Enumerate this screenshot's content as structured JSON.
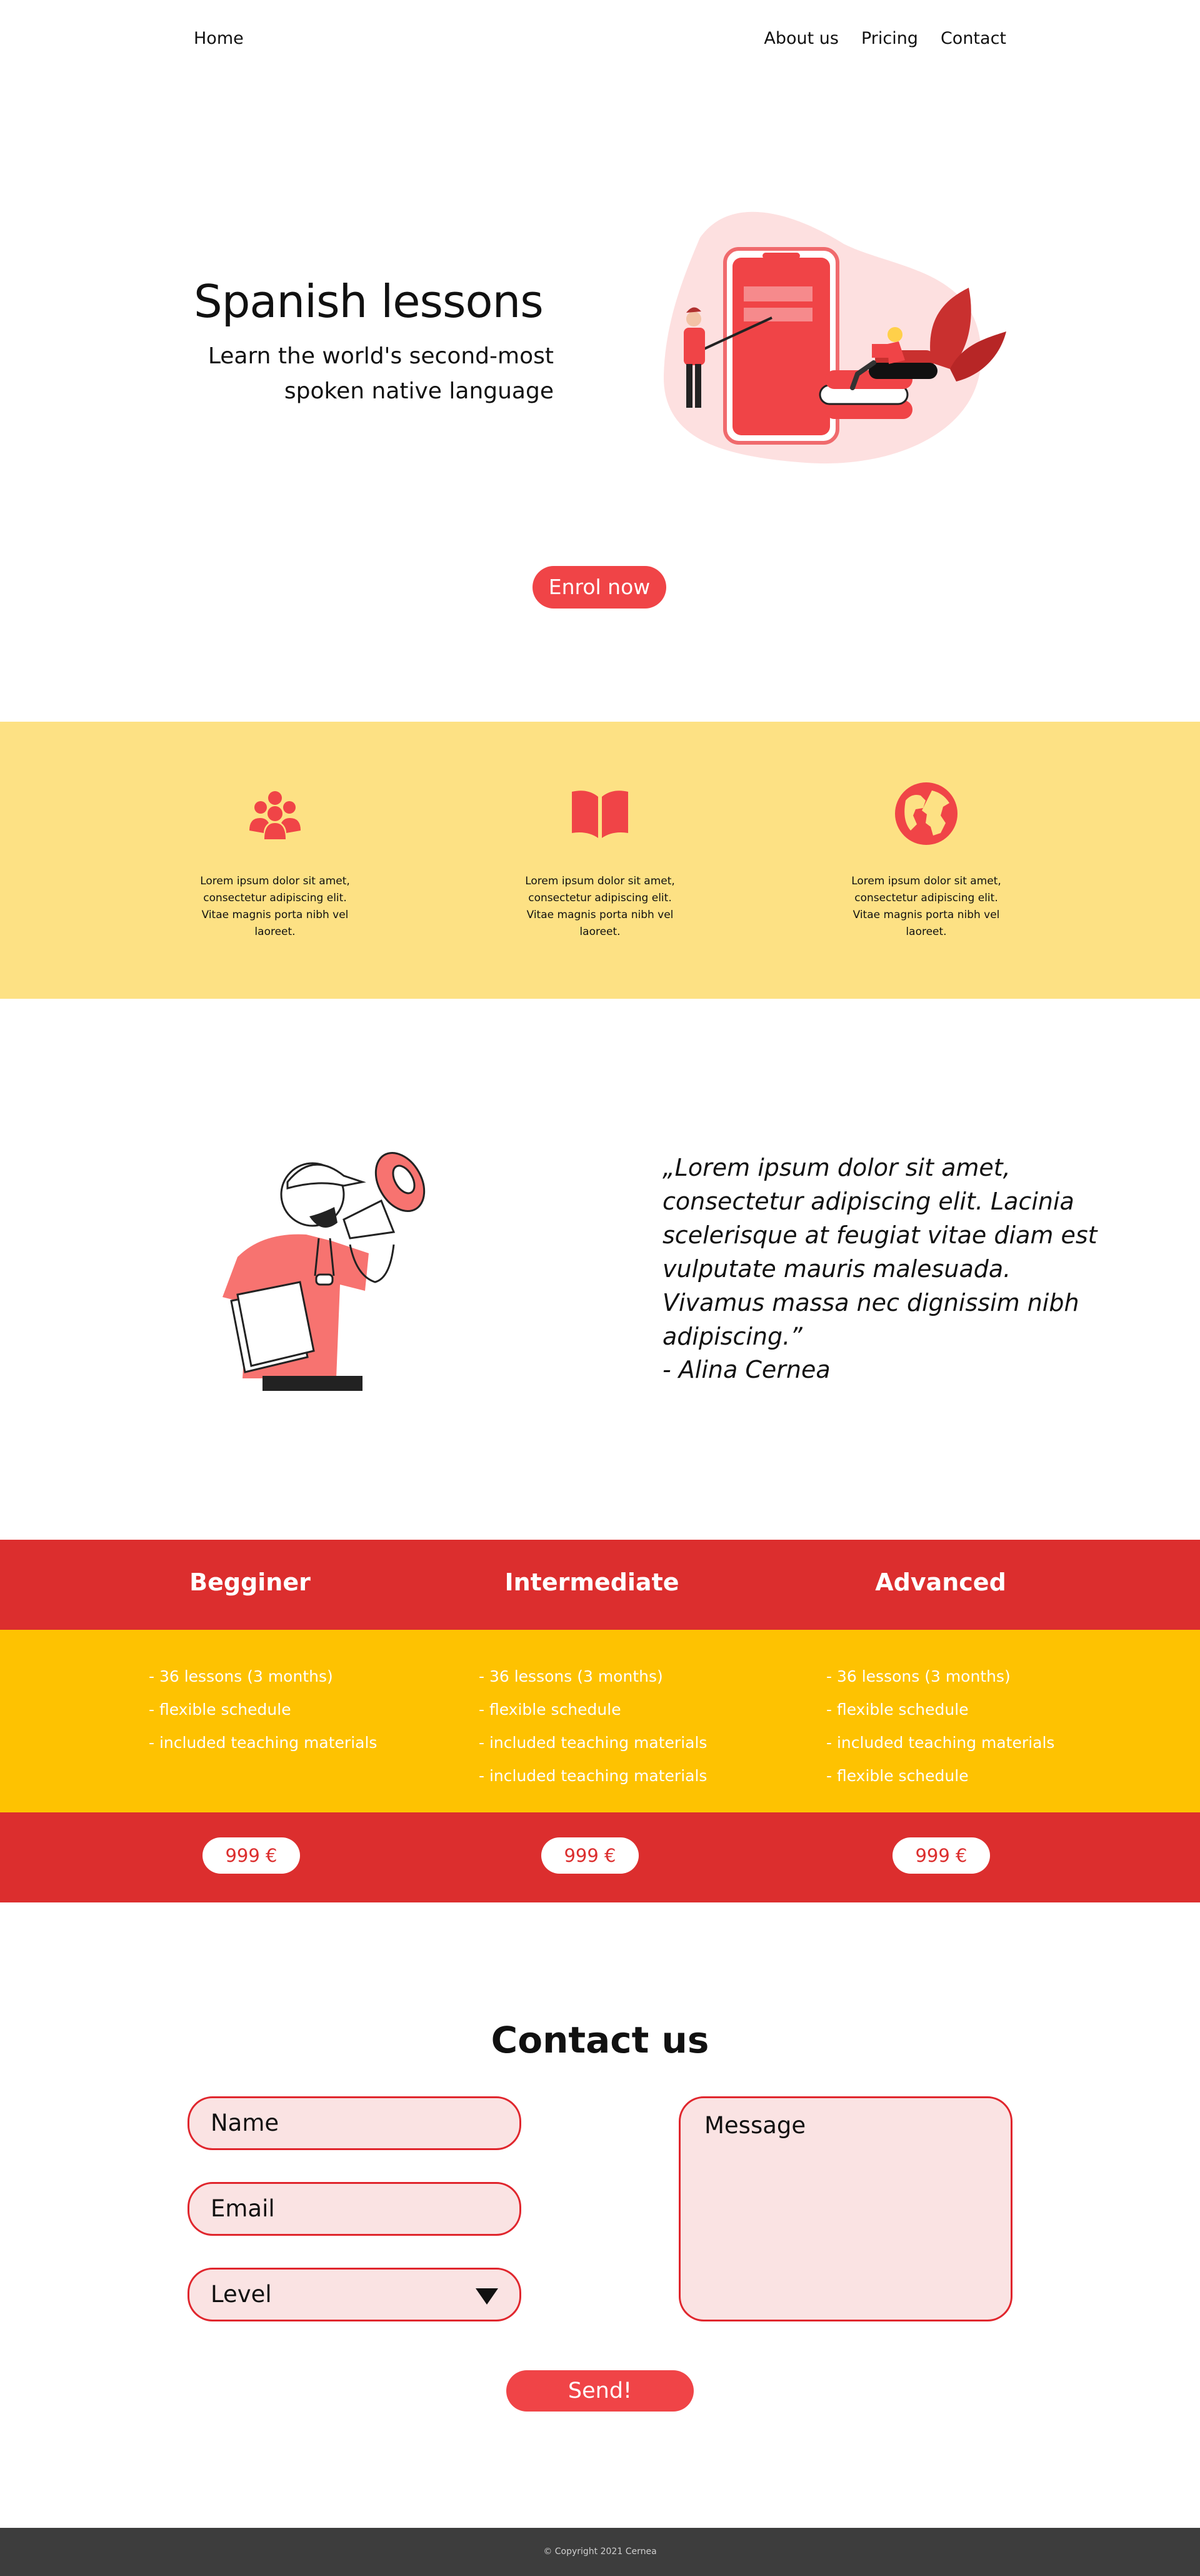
{
  "nav": {
    "home": "Home",
    "links": [
      "About us",
      "Pricing",
      "Contact"
    ]
  },
  "hero": {
    "title": "Spanish lessons",
    "subtitle": "Learn the world's second-most spoken native language",
    "cta": "Enrol now"
  },
  "features": {
    "items": [
      {
        "icon": "group-icon",
        "text": "Lorem ipsum dolor sit amet, consectetur adipiscing elit. Vitae magnis porta nibh vel laoreet."
      },
      {
        "icon": "book-icon",
        "text": "Lorem ipsum dolor sit amet, consectetur adipiscing elit. Vitae magnis porta nibh vel laoreet."
      },
      {
        "icon": "globe-icon",
        "text": "Lorem ipsum dolor sit amet, consectetur adipiscing elit. Vitae magnis porta nibh vel laoreet."
      }
    ]
  },
  "testimonial": {
    "quote": "„Lorem ipsum dolor sit amet, consectetur adipiscing elit. Lacinia scelerisque at feugiat vitae diam est vulputate mauris malesuada. Vivamus massa nec dignissim nibh adipiscing.”",
    "author": "- Alina Cernea"
  },
  "pricing": {
    "plans": [
      {
        "title": "Begginer",
        "features": [
          "- 36 lessons (3 months)",
          "- flexible schedule",
          "- included teaching materials"
        ],
        "price": "999 €"
      },
      {
        "title": "Intermediate",
        "features": [
          "- 36 lessons (3 months)",
          "- flexible schedule",
          "- included teaching materials",
          "- included teaching materials"
        ],
        "price": "999 €"
      },
      {
        "title": "Advanced",
        "features": [
          "- 36 lessons (3 months)",
          "- flexible schedule",
          "- included teaching materials",
          "- flexible schedule"
        ],
        "price": "999 €"
      }
    ]
  },
  "contact": {
    "title": "Contact us",
    "name_placeholder": "Name",
    "email_placeholder": "Email",
    "level_placeholder": "Level",
    "message_placeholder": "Message",
    "send": "Send!"
  },
  "footer": {
    "copyright": "© Copyright 2021 Cernea"
  },
  "colors": {
    "accent": "#f04447",
    "red": "#dc2e2e",
    "yellow_light": "#fde184",
    "yellow": "#fec201",
    "footer": "#3d3d3d"
  }
}
